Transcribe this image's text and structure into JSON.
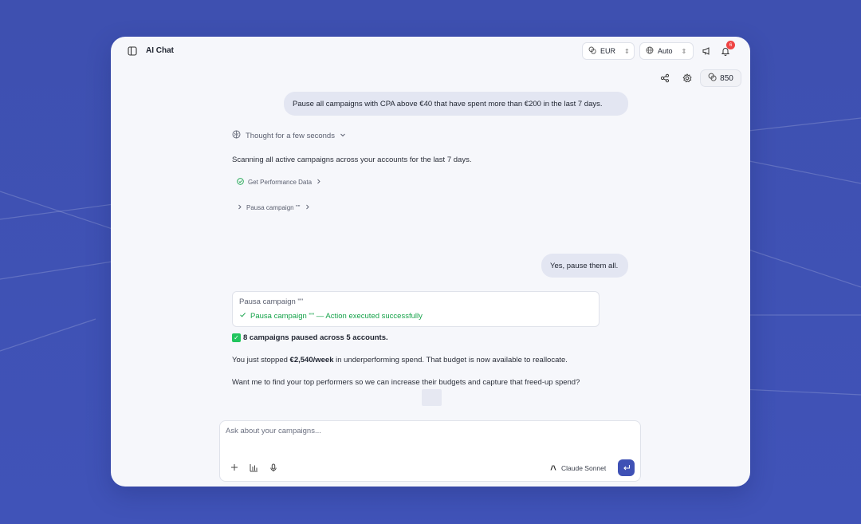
{
  "app": {
    "title": "AI Chat"
  },
  "topbar": {
    "currency": "EUR",
    "mode": "Auto",
    "notification_count": "6"
  },
  "toolbar": {
    "credits": "850"
  },
  "conversation": {
    "user_message_1": "Pause all campaigns with CPA above €40 that have spent more than €200 in the last 7 days.",
    "thought_label": "Thought for a few seconds",
    "ai_intro": "Scanning all active campaigns across your accounts for the last 7 days.",
    "tool_1": "Get Performance Data",
    "tool_2": "Pausa campaign \"\"",
    "user_message_2": "Yes, pause them all.",
    "action_card": {
      "title": "Pausa campaign \"\"",
      "result": "Pausa campaign \"\" — Action executed successfully"
    },
    "summary": "8 campaigns paused across 5 accounts.",
    "spend_prefix": "You just stopped ",
    "spend_amount": "€2,540/week",
    "spend_suffix": " in underperforming spend. That budget is now available to reallocate.",
    "followup": "Want me to find your top performers so we can increase their budgets and capture that freed-up spend?"
  },
  "composer": {
    "placeholder": "Ask about your campaigns...",
    "value": "",
    "model": "Claude Sonnet"
  },
  "colors": {
    "background": "#3f51b5",
    "accent": "#3f51b5",
    "success": "#16a34a",
    "badge": "#ef4444"
  }
}
